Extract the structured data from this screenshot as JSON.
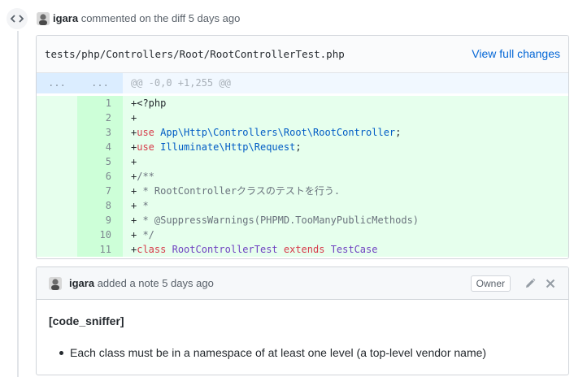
{
  "event": {
    "author": "igara",
    "action": "commented on the diff 5 days ago"
  },
  "diff": {
    "file_path": "tests/php/Controllers/Root/RootControllerTest.php",
    "view_full_label": "View full changes",
    "hunk": {
      "old": "...",
      "new": "...",
      "header": "@@ -0,0 +1,255 @@"
    },
    "lines": [
      {
        "n": "1",
        "text": "+<?php"
      },
      {
        "n": "2",
        "text": "+"
      },
      {
        "n": "3",
        "text": "+use App\\Http\\Controllers\\Root\\RootController;"
      },
      {
        "n": "4",
        "text": "+use Illuminate\\Http\\Request;"
      },
      {
        "n": "5",
        "text": "+"
      },
      {
        "n": "6",
        "text": "+/**"
      },
      {
        "n": "7",
        "text": "+ * RootControllerクラスのテストを行う."
      },
      {
        "n": "8",
        "text": "+ *"
      },
      {
        "n": "9",
        "text": "+ * @SuppressWarnings(PHPMD.TooManyPublicMethods)"
      },
      {
        "n": "10",
        "text": "+ */"
      },
      {
        "n": "11",
        "text": "+class RootControllerTest extends TestCase"
      }
    ]
  },
  "note": {
    "author": "igara",
    "action": "added a note 5 days ago",
    "badge": "Owner",
    "heading": "[code_sniffer]",
    "items": [
      "Each class must be in a namespace of at least one level (a top-level vendor name)"
    ]
  },
  "colors": {
    "link": "#0366d6",
    "addition_bg": "#e6ffed",
    "addition_num_bg": "#cdffd8",
    "hunk_bg": "#f1f8ff"
  },
  "icons": {
    "timeline_badge": "code-icon",
    "edit": "pencil-icon",
    "close": "x-icon"
  }
}
